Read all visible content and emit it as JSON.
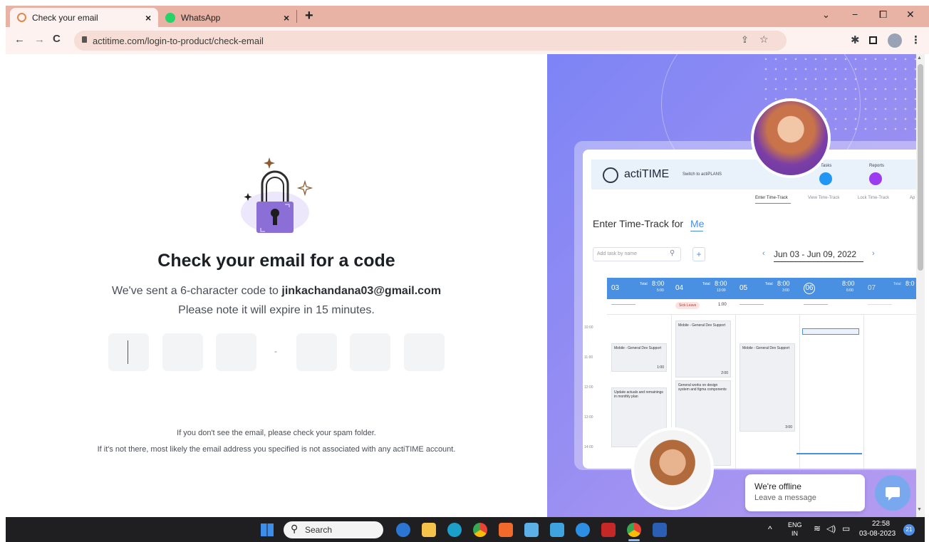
{
  "browser": {
    "tabs": [
      {
        "label": "Check your email",
        "icon": "actitime-tab-icon",
        "active": true
      },
      {
        "label": "WhatsApp",
        "icon": "whatsapp-icon",
        "active": false
      }
    ],
    "new_tab": "+",
    "url": "actitime.com/login-to-product/check-email",
    "window_controls": [
      "⌄",
      "−",
      "⧠",
      "✕"
    ]
  },
  "auth": {
    "title": "Check your email for a code",
    "sent_prefix": "We've sent a 6-character code to ",
    "email": "jinkachandana03@gmail.com",
    "expire_note": "Please note it will expire in 15 minutes.",
    "code_separator": "-",
    "code_boxes": 6,
    "spam_note": "If you don't see the email, please check your spam folder.",
    "not_found_note": "If it's not there, most likely the email address you specified is not associated with any actiTIME account."
  },
  "promo": {
    "logo": "actiTIME",
    "switch_label": "Switch to actiPLANS",
    "nav": {
      "tasks": "Tasks",
      "reports": "Reports"
    },
    "subnav": [
      "Enter Time-Track",
      "View Time-Track",
      "Lock Time-Track",
      "Ap"
    ],
    "heading": "Enter Time-Track for",
    "heading_user": "Me",
    "add_task_placeholder": "Add task by name",
    "date_range": "Jun 03 - Jun 09, 2022",
    "days": [
      {
        "num": "03",
        "total_label": "Total",
        "total": "8:00",
        "sub": "5:00"
      },
      {
        "num": "04",
        "total_label": "Total",
        "total": "8:00",
        "sub": "13:00"
      },
      {
        "num": "05",
        "total_label": "Total",
        "total": "8:00",
        "sub": "3:00"
      },
      {
        "num": "06",
        "total_label": "",
        "total": "8:00",
        "sub": "6:00"
      },
      {
        "num": "07",
        "total_label": "Total",
        "total": "8:0",
        "sub": ""
      }
    ],
    "sick_leave": "Sick Leave",
    "sick_leave_time": "1:00",
    "hours": [
      "10:00",
      "11:00",
      "12:00",
      "13:00",
      "14:00"
    ],
    "cards": [
      {
        "text": "Mobile - General Dev Support",
        "time": "1:00"
      },
      {
        "text": "Mobile - General Dev Support",
        "time": "2:00"
      },
      {
        "text": "Mobile - General Dev Support",
        "time": "3:00"
      },
      {
        "text": "Update actuals and remainings in monthly plan",
        "time": ""
      },
      {
        "text": "General works on design system and figma components",
        "time": ""
      }
    ],
    "chat_title": "We're offline",
    "chat_sub": "Leave a message"
  },
  "taskbar": {
    "search_placeholder": "Search",
    "lang_top": "ENG",
    "lang_bottom": "IN",
    "time": "22:58",
    "date": "03-08-2023",
    "notifications": "21"
  },
  "colors": {
    "tab_strip": "#e8b2a5",
    "toolbar": "#fdf2ef",
    "lock_purple": "#8b6fd6",
    "promo_bg": "#8a8cf3",
    "day_header": "#4a90e2",
    "taskbar": "#1f1f21"
  }
}
